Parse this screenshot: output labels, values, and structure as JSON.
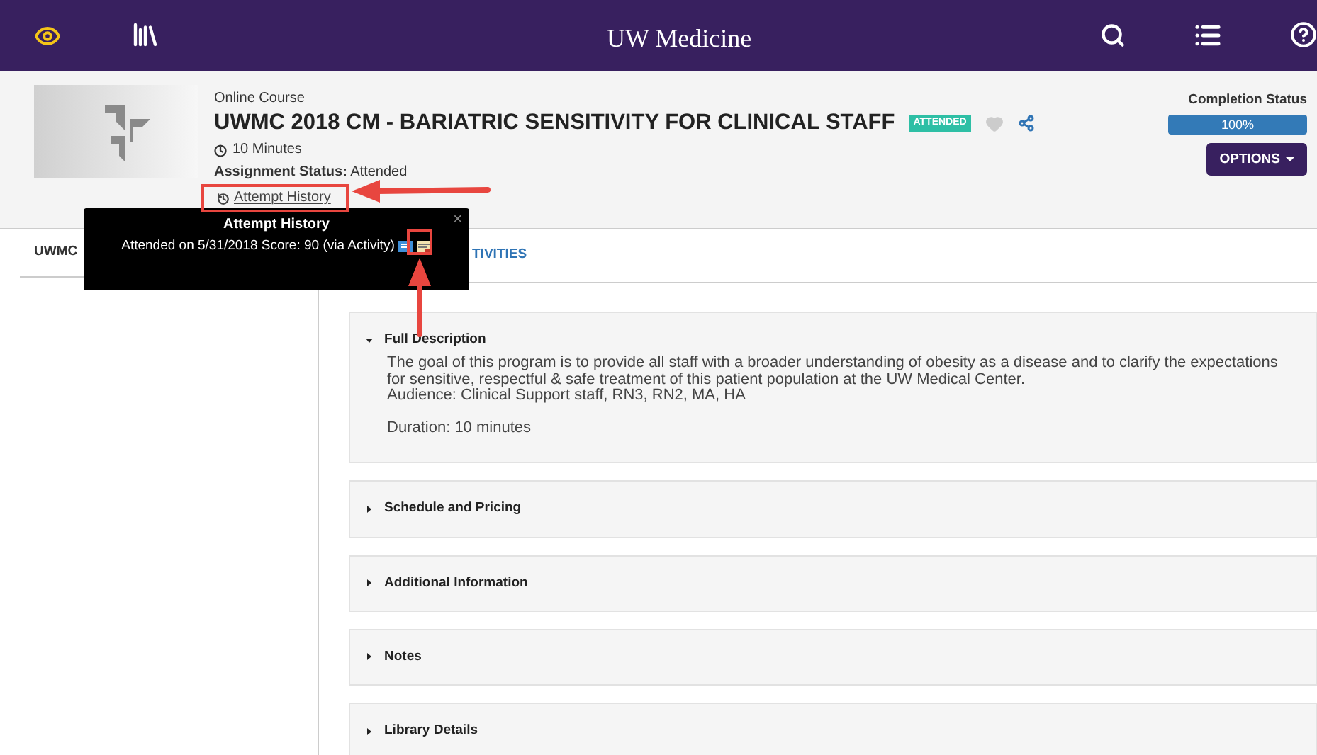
{
  "nav": {
    "brand": "UW Medicine"
  },
  "course": {
    "type_label": "Online Course",
    "title": "UWMC 2018 CM - BARIATRIC SENSITIVITY FOR CLINICAL STAFF",
    "badge": "ATTENDED",
    "favorite": false,
    "duration": "10 Minutes",
    "status_label": "Assignment Status:",
    "status_value": "Attended",
    "history_link": "Attempt History"
  },
  "completion": {
    "label": "Completion Status",
    "level": 1,
    "reading": "100%"
  },
  "options_button": "OPTIONS",
  "left_tab": "UWMC",
  "main_tab": "TIVITIES",
  "popup": {
    "title": "Attempt History",
    "close": "×",
    "entry": "Attended on 5/31/2018 Score: 90 (via Activity)"
  },
  "sections": [
    {
      "title": "Full Description",
      "expanded": true,
      "paragraphs": [
        "The goal of this program is to provide all staff with a broader understanding of obesity as a disease and to clarify the expectations for sensitive, respectful & safe treatment of this patient population at the UW Medical Center.",
        "Audience: Clinical Support staff, RN3, RN2, MA, HA"
      ],
      "duration": "Duration: 10 minutes"
    },
    {
      "title": "Schedule and Pricing",
      "expanded": false
    },
    {
      "title": "Additional Information",
      "expanded": false
    },
    {
      "title": "Notes",
      "expanded": false
    },
    {
      "title": "Library Details",
      "expanded": false
    }
  ]
}
